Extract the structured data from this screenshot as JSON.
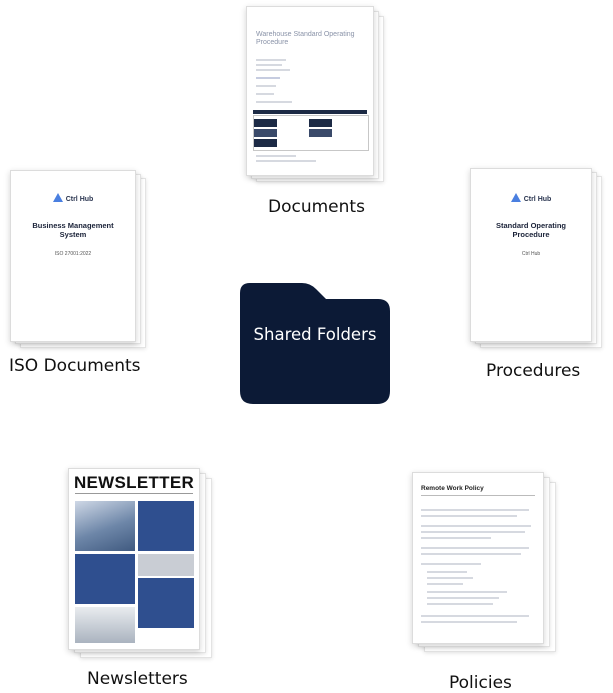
{
  "center": {
    "label": "Shared Folders",
    "color": "#0c1a36"
  },
  "documents": {
    "label": "Documents",
    "doc_title": "Warehouse Standard Operating Procedure"
  },
  "iso": {
    "label": "ISO Documents",
    "brand": "Ctrl Hub",
    "doc_title": "Business Management System",
    "doc_sub": "ISO 27001:2022"
  },
  "procedures": {
    "label": "Procedures",
    "brand": "Ctrl Hub",
    "doc_title": "Standard Operating Procedure",
    "doc_sub": "Ctrl Hub"
  },
  "newsletters": {
    "label": "Newsletters",
    "doc_title": "NEWSLETTER"
  },
  "policies": {
    "label": "Policies",
    "doc_title": "Remote Work Policy"
  },
  "colors": {
    "navy": "#0c1a36",
    "accent": "#4a7fe0",
    "newsletter_blue": "#2f4f8f"
  }
}
